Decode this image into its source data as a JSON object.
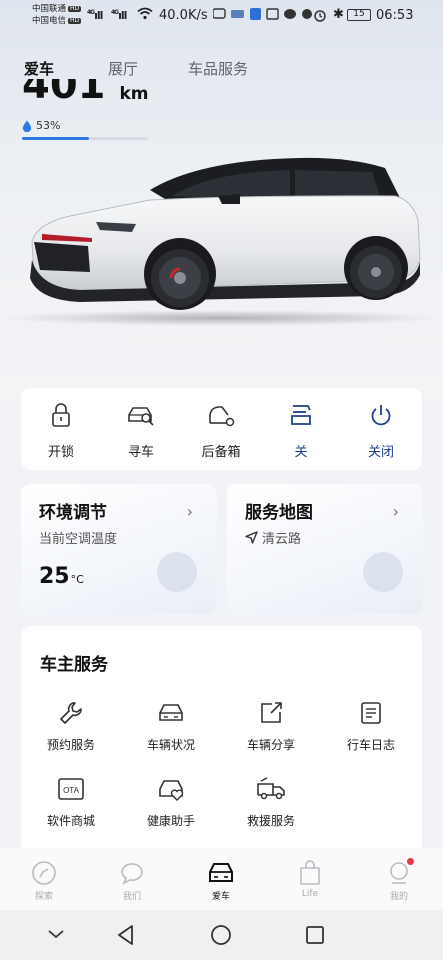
{
  "status_bar": {
    "carrier1": "中国联通",
    "carrier2": "中国电信",
    "hd": "HD",
    "signal1": "4G",
    "signal2": "4G",
    "net_speed": "40.0K/s",
    "battery": "15",
    "time": "06:53"
  },
  "top_tabs": [
    {
      "label": "爱车",
      "active": true
    },
    {
      "label": "展厅",
      "active": false
    },
    {
      "label": "车品服务",
      "active": false
    }
  ],
  "vehicle": {
    "mileage": "401",
    "mileage_unit": "km",
    "charge_percent": "53%",
    "charge_level": 0.53
  },
  "controls": [
    {
      "label": "开锁",
      "icon": "lock-icon"
    },
    {
      "label": "寻车",
      "icon": "find-car-icon"
    },
    {
      "label": "后备箱",
      "icon": "trunk-icon"
    },
    {
      "label": "关",
      "icon": "window-icon"
    },
    {
      "label": "关闭",
      "icon": "power-icon"
    }
  ],
  "climate": {
    "title": "环境调节",
    "subtitle": "当前空调温度",
    "temperature": "25",
    "unit": "°C"
  },
  "service_map": {
    "title": "服务地图",
    "location": "清云路"
  },
  "owner_services": {
    "title": "车主服务",
    "items": [
      {
        "label": "预约服务",
        "icon": "wrench-icon"
      },
      {
        "label": "车辆状况",
        "icon": "car-status-icon"
      },
      {
        "label": "车辆分享",
        "icon": "share-icon"
      },
      {
        "label": "行车日志",
        "icon": "log-icon"
      },
      {
        "label": "软件商城",
        "icon": "ota-icon"
      },
      {
        "label": "健康助手",
        "icon": "health-icon"
      },
      {
        "label": "救援服务",
        "icon": "rescue-icon"
      }
    ],
    "ota_text": "OTA"
  },
  "bottom_nav": [
    {
      "label": "探索",
      "active": false
    },
    {
      "label": "我们",
      "active": false
    },
    {
      "label": "爱车",
      "active": true
    },
    {
      "label": "Life",
      "active": false
    },
    {
      "label": "我的",
      "active": false
    }
  ],
  "colors": {
    "accent_blue": "#1e3f8a",
    "charge_bar": "#2c7be5",
    "badge_red": "#e8374a"
  }
}
